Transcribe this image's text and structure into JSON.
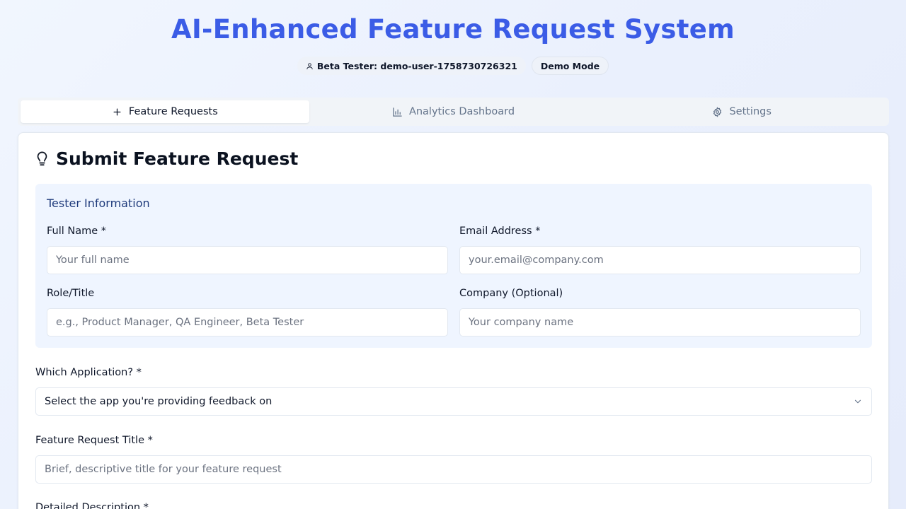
{
  "header": {
    "title": "AI-Enhanced Feature Request System",
    "tester_badge": "Beta Tester: demo-user-1758730726321",
    "mode_badge": "Demo Mode"
  },
  "tabs": [
    {
      "label": "Feature Requests",
      "icon": "plus-icon",
      "active": true
    },
    {
      "label": "Analytics Dashboard",
      "icon": "bar-chart-icon",
      "active": false
    },
    {
      "label": "Settings",
      "icon": "gear-icon",
      "active": false
    }
  ],
  "form": {
    "title": "Submit Feature Request",
    "tester_info": {
      "heading": "Tester Information",
      "full_name": {
        "label": "Full Name *",
        "placeholder": "Your full name",
        "value": ""
      },
      "email": {
        "label": "Email Address *",
        "placeholder": "your.email@company.com",
        "value": ""
      },
      "role": {
        "label": "Role/Title",
        "placeholder": "e.g., Product Manager, QA Engineer, Beta Tester",
        "value": ""
      },
      "company": {
        "label": "Company (Optional)",
        "placeholder": "Your company name",
        "value": ""
      }
    },
    "application": {
      "label": "Which Application? *",
      "selected": "Select the app you're providing feedback on"
    },
    "request_title": {
      "label": "Feature Request Title *",
      "placeholder": "Brief, descriptive title for your feature request",
      "value": ""
    },
    "description": {
      "label": "Detailed Description *"
    }
  },
  "colors": {
    "accent": "#3b5ce6",
    "tester_box_bg": "#eff5ff",
    "tester_heading": "#1e3a7b"
  }
}
